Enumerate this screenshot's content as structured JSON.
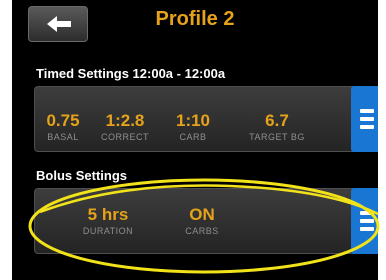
{
  "header": {
    "title": "Profile 2",
    "back_icon": "left-arrow-icon"
  },
  "timed_settings": {
    "heading": "Timed Settings  12:00a - 12:00a",
    "fields": [
      {
        "value": "0.75",
        "label": "BASAL"
      },
      {
        "value": "1:2.8",
        "label": "CORRECT"
      },
      {
        "value": "1:10",
        "label": "CARB"
      },
      {
        "value": "6.7",
        "label": "TARGET BG"
      }
    ],
    "menu_icon": "hamburger-menu-icon"
  },
  "bolus_settings": {
    "heading": "Bolus Settings",
    "fields": [
      {
        "value": "5 hrs",
        "label": "DURATION"
      },
      {
        "value": "ON",
        "label": "CARBS"
      }
    ],
    "menu_icon": "hamburger-menu-icon"
  },
  "colors": {
    "accent": "#e5a21a",
    "menu_button": "#1976d2",
    "highlight": "#f2e21a",
    "background": "#000000"
  }
}
